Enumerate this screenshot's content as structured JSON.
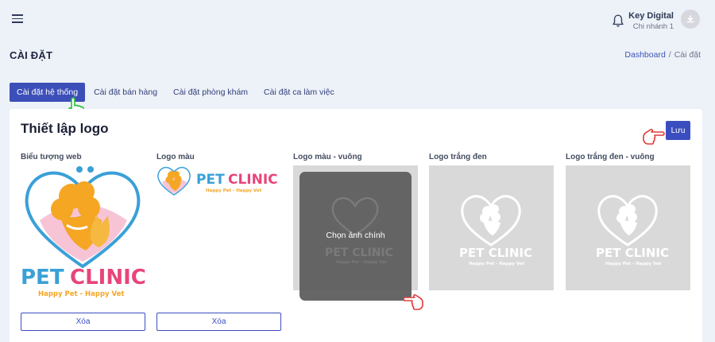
{
  "header": {
    "user_name": "Key Digital",
    "user_branch": "Chi nhánh 1"
  },
  "page": {
    "title": "CÀI ĐẶT",
    "breadcrumb": [
      "Dashboard",
      "/",
      "Cài đặt"
    ]
  },
  "tabs": [
    {
      "label": "Cài đặt hệ thống",
      "active": true
    },
    {
      "label": "Cài đặt bán hàng",
      "active": false
    },
    {
      "label": "Cài đặt phòng khám",
      "active": false
    },
    {
      "label": "Cài đặt ca làm việc",
      "active": false
    }
  ],
  "card": {
    "title": "Thiết lập logo",
    "save_label": "Lưu",
    "columns": [
      {
        "label": "Biểu tượng web"
      },
      {
        "label": "Logo màu"
      },
      {
        "label": "Logo màu - vuông"
      },
      {
        "label": "Logo trắng đen"
      },
      {
        "label": "Logo trắng đen - vuông"
      }
    ],
    "delete_label": "Xóa",
    "overlay_text": "Chọn ảnh chính"
  },
  "logo": {
    "brand": "PET CLINIC",
    "brand_word1": "PET",
    "brand_word2": "CLINIC",
    "tagline": "Happy Pet - Happy Vet"
  },
  "colors": {
    "accent": "#3c4fb8",
    "brand_blue": "#3aa0d8",
    "brand_pink": "#e8457a",
    "brand_orange": "#f5a623",
    "hand_green": "#27c13a",
    "hand_red": "#e23b3b"
  }
}
